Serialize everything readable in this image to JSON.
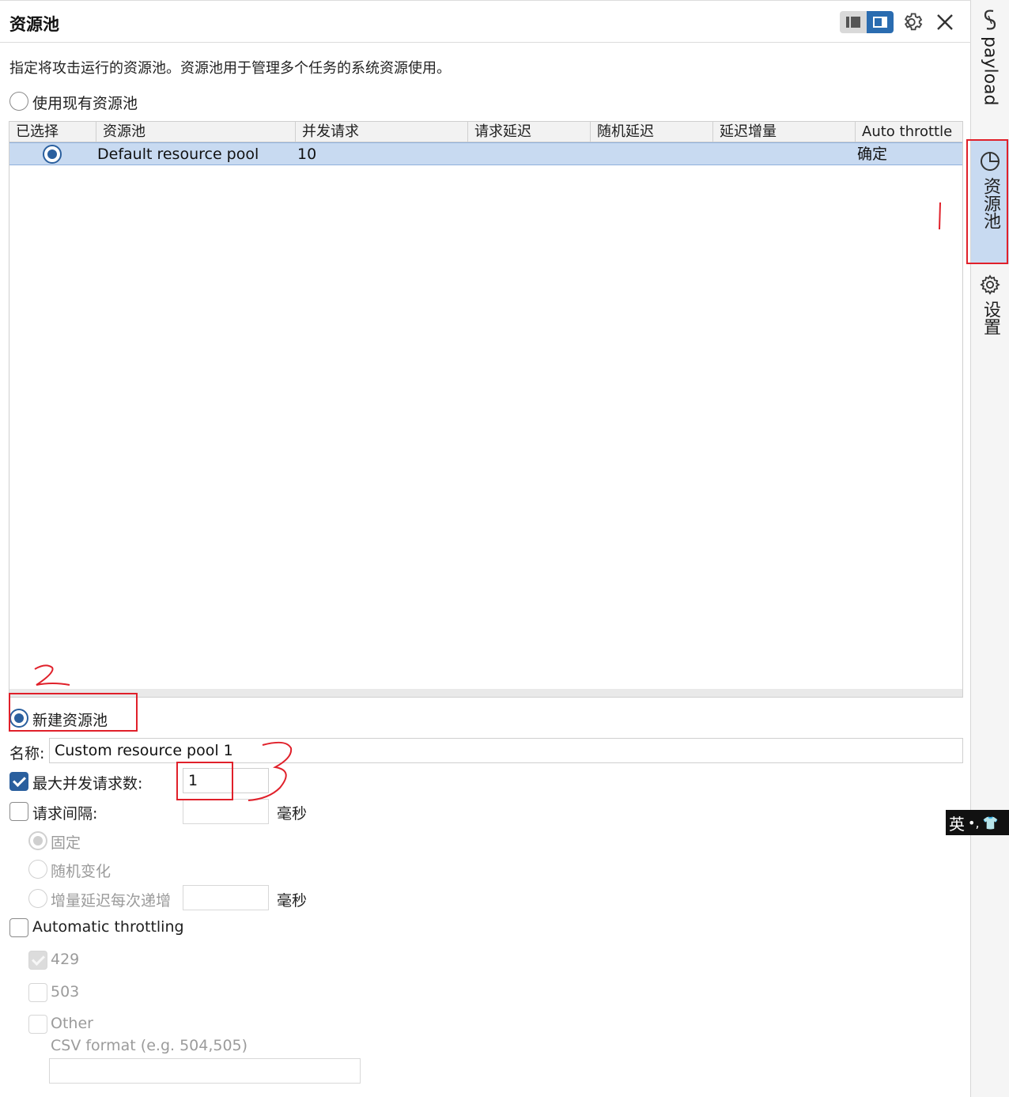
{
  "header": {
    "title": "资源池"
  },
  "description": "指定将攻击运行的资源池。资源池用于管理多个任务的系统资源使用。",
  "use_existing": {
    "label": "使用现有资源池"
  },
  "table": {
    "columns": [
      "已选择",
      "资源池",
      "并发请求",
      "请求延迟",
      "随机延迟",
      "延迟增量",
      "Auto throttle"
    ],
    "rows": [
      {
        "name": "Default resource pool",
        "concurrent": "10",
        "request_delay": "",
        "random_delay": "",
        "delay_increment": "",
        "auto_throttle": "确定"
      }
    ]
  },
  "new_pool": {
    "label": "新建资源池"
  },
  "name_field": {
    "label": "名称:",
    "value": "Custom resource pool 1"
  },
  "max_concurrent": {
    "label": "最大并发请求数:",
    "value": "1"
  },
  "request_interval": {
    "label": "请求间隔:",
    "unit": "毫秒"
  },
  "interval_options": {
    "fixed": "固定",
    "random": "随机变化",
    "increment": "增量延迟每次递增",
    "increment_unit": "毫秒"
  },
  "auto_throttling": {
    "label": "Automatic throttling",
    "options": [
      "429",
      "503",
      "Other"
    ],
    "csv_hint": "CSV format (e.g. 504,505)"
  },
  "sidebar": {
    "tabs": [
      "payload",
      "资源池",
      "设置"
    ]
  },
  "annotations": [
    "1",
    "2",
    "3"
  ],
  "ime": {
    "label": "英"
  },
  "colors": {
    "accent": "#2a5f9e",
    "selection": "#c8daf1",
    "annotation": "#e0202a"
  }
}
